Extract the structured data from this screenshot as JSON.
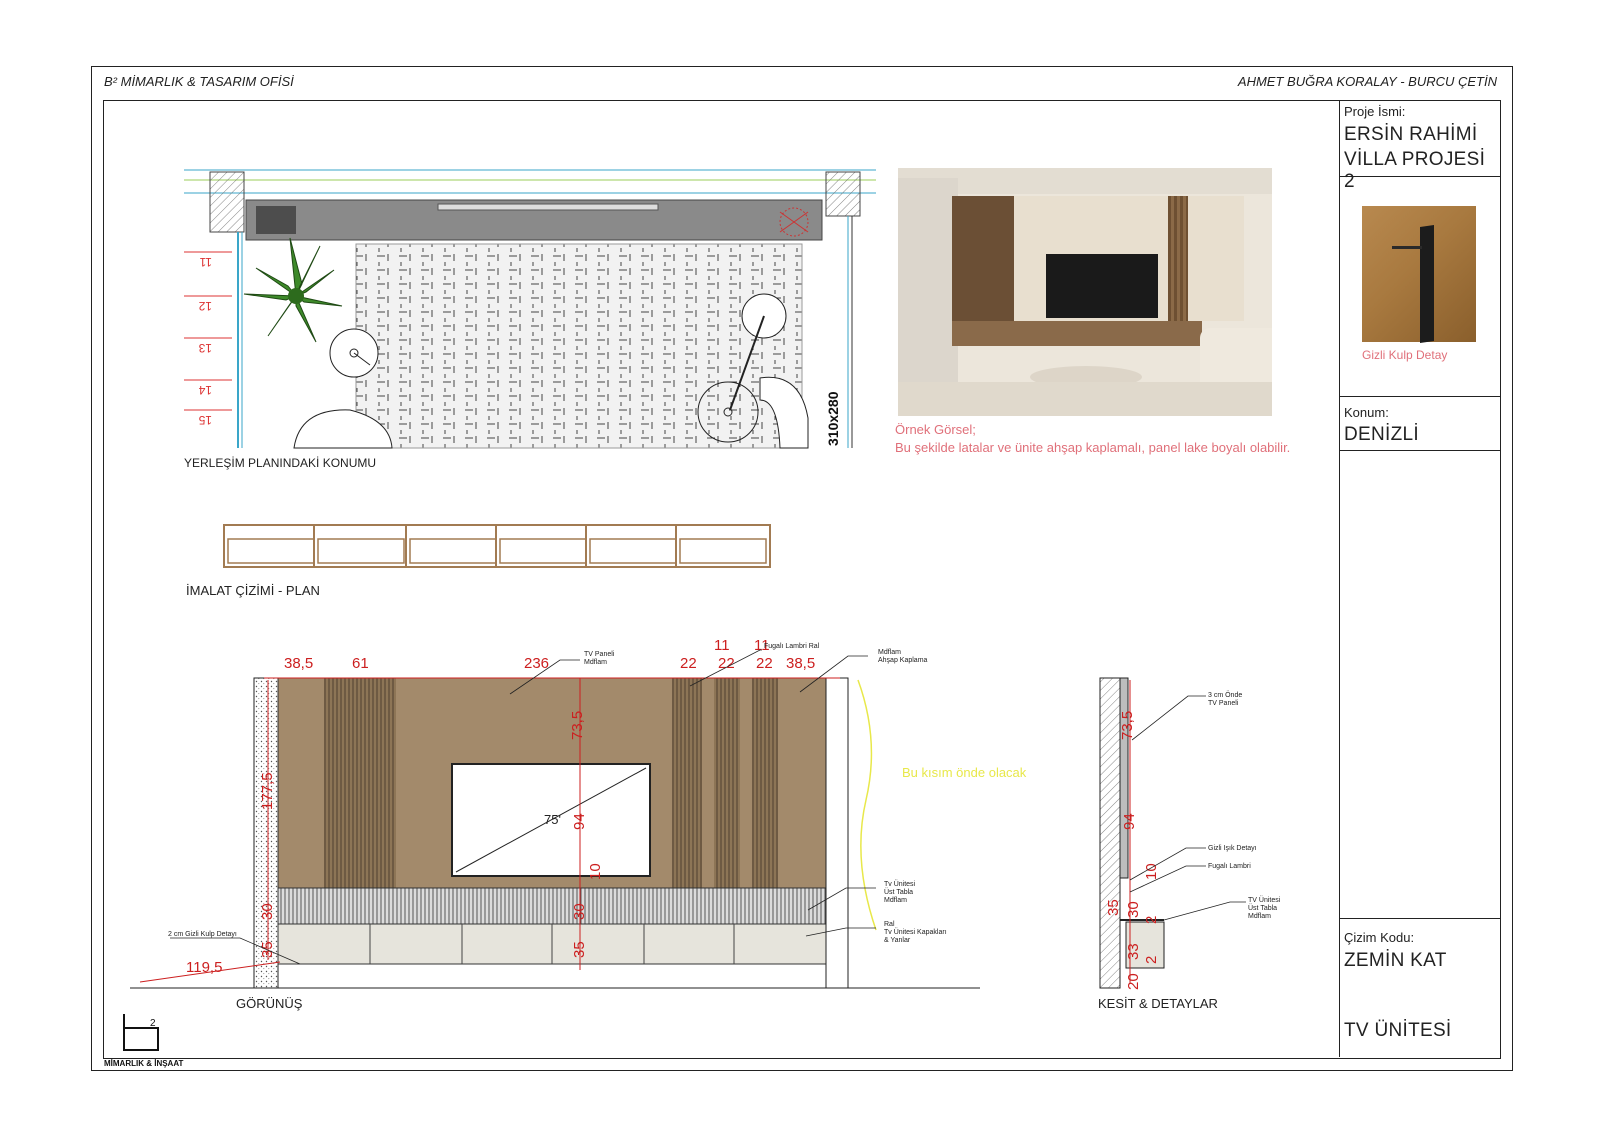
{
  "header": {
    "office": "B² MİMARLIK & TASARIM OFİSİ",
    "authors": "AHMET BUĞRA KORALAY - BURCU ÇETİN"
  },
  "title_block": {
    "project_label": "Proje İsmi:",
    "project_line1": "ERSİN RAHİMİ",
    "project_line2": "VİLLA PROJESİ  2",
    "detail_caption": "Gizli Kulp Detay",
    "location_label": "Konum:",
    "location_value": "DENİZLİ",
    "code_label": "Çizim Kodu:",
    "code_value": "ZEMİN KAT",
    "drawing_name": "TV ÜNİTESİ"
  },
  "plan": {
    "caption": "YERLEŞİM PLANINDAKİ KONUMU",
    "rug_size": "310x280",
    "stair_numbers": [
      "11",
      "12",
      "13",
      "14",
      "15"
    ]
  },
  "sample": {
    "title": "Örnek Görsel;",
    "note": "Bu şekilde latalar ve ünite ahşap kaplamalı, panel lake boyalı olabilir."
  },
  "manufacturing": {
    "caption": "İMALAT ÇİZİMİ - PLAN"
  },
  "elevation": {
    "caption": "GÖRÜNÜŞ",
    "dims_top": [
      "38,5",
      "61",
      "236",
      "22",
      "11",
      "22",
      "11",
      "22",
      "38,5"
    ],
    "dims_vertical": [
      "73,5",
      "94",
      "10",
      "30",
      "35"
    ],
    "dims_left": [
      "177,5",
      "30",
      "35"
    ],
    "dim_width": "119,5",
    "tv_size": "75'",
    "note_front": "Bu kısım önde olacak",
    "labels": {
      "tv_panel": [
        "TV Paneli",
        "Mdflam"
      ],
      "fugali": "Fugalı Lambri Ral",
      "mdflam": [
        "Mdflam",
        "Ahşap Kaplama"
      ],
      "tv_unit_top": [
        "Tv Ünitesi",
        "Üst Tabla",
        "Mdflam"
      ],
      "tv_unit_doors": [
        "Ral",
        "Tv Ünitesi Kapakları",
        "&    Yanlar"
      ],
      "hidden_handle": "2 cm Gizli Kulp Detayı"
    }
  },
  "section": {
    "caption": "KESİT & DETAYLAR",
    "dims": [
      "73,5",
      "94",
      "10",
      "35",
      "30",
      "33",
      "20",
      "2",
      "2"
    ],
    "labels": {
      "front_panel": [
        "3 cm Önde",
        "TV Paneli"
      ],
      "hidden_light": "Gizli Işık Detayı",
      "fugali": "Fugalı Lambri",
      "top": [
        "TV Ünitesi",
        "Üst Tabla",
        "Mdflam"
      ]
    }
  },
  "logo": {
    "mark": "b²",
    "text": "MİMARLIK & İNŞAAT"
  },
  "colors": {
    "wood": "#a38a6b",
    "wood_dark": "#8f7758",
    "dim_red": "#cc1f1f",
    "note_pink": "#e0707a",
    "note_yellow": "#e8e84a",
    "unit_gray": "#e6e4dc"
  }
}
